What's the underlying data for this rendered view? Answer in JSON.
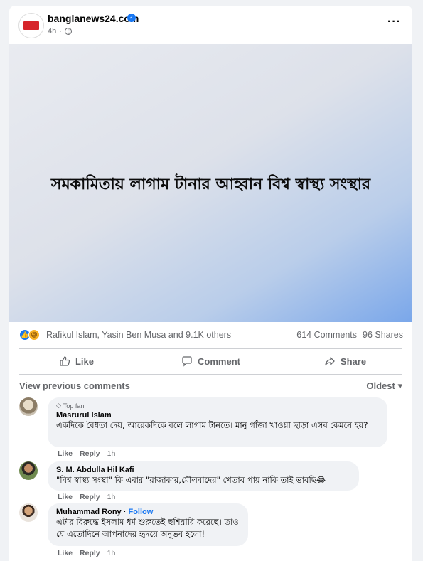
{
  "post": {
    "page_name": "banglanews24.com",
    "logo_text": "banglanews24",
    "time": "4h",
    "image_text": "সমকামিতায় লাগাম টানার আহ্বান বিশ্ব স্বাস্থ্য সংস্থার"
  },
  "reactions": {
    "names": "Rafikul Islam, Yasin Ben Musa and 9.1K others",
    "comments_count": "614 Comments",
    "shares_count": "96 Shares"
  },
  "actions": {
    "like": "Like",
    "comment": "Comment",
    "share": "Share"
  },
  "comments_section": {
    "view_previous": "View previous comments",
    "sort": "Oldest"
  },
  "comments": [
    {
      "badge": "Top fan",
      "author": "Masrurul Islam",
      "text": "একদিকে বৈধতা দেয়, আরেকদিকে বলে লাগাম টানতে। মানু গাঁজা খাওয়া ছাড়া এসব কেমনে হয়?",
      "like": "Like",
      "reply": "Reply",
      "time": "1h"
    },
    {
      "author": "S. M. Abdulla Hil Kafi",
      "text": "\"বিশ্ব স্বাস্থ্য সংস্থা\" কি এবার \"রাজাকার,মৌলবাদের\" খেতাব পায় নাকি তাই ভাবছি😂",
      "like": "Like",
      "reply": "Reply",
      "time": "1h"
    },
    {
      "author": "Muhammad Rony",
      "follow": "Follow",
      "text": "এটার বিরুদ্ধে ইসলাম ধর্ম শুরুতেই হুশিয়ারি করেছে। তাও যে এতোদিনে আপনাদের হৃদয়ে অনুভব হলো!",
      "like": "Like",
      "reply": "Reply",
      "time": "1h"
    }
  ],
  "colors": {
    "accent": "#1877f2",
    "muted_text": "#65676b",
    "bubble": "#f0f2f5"
  }
}
